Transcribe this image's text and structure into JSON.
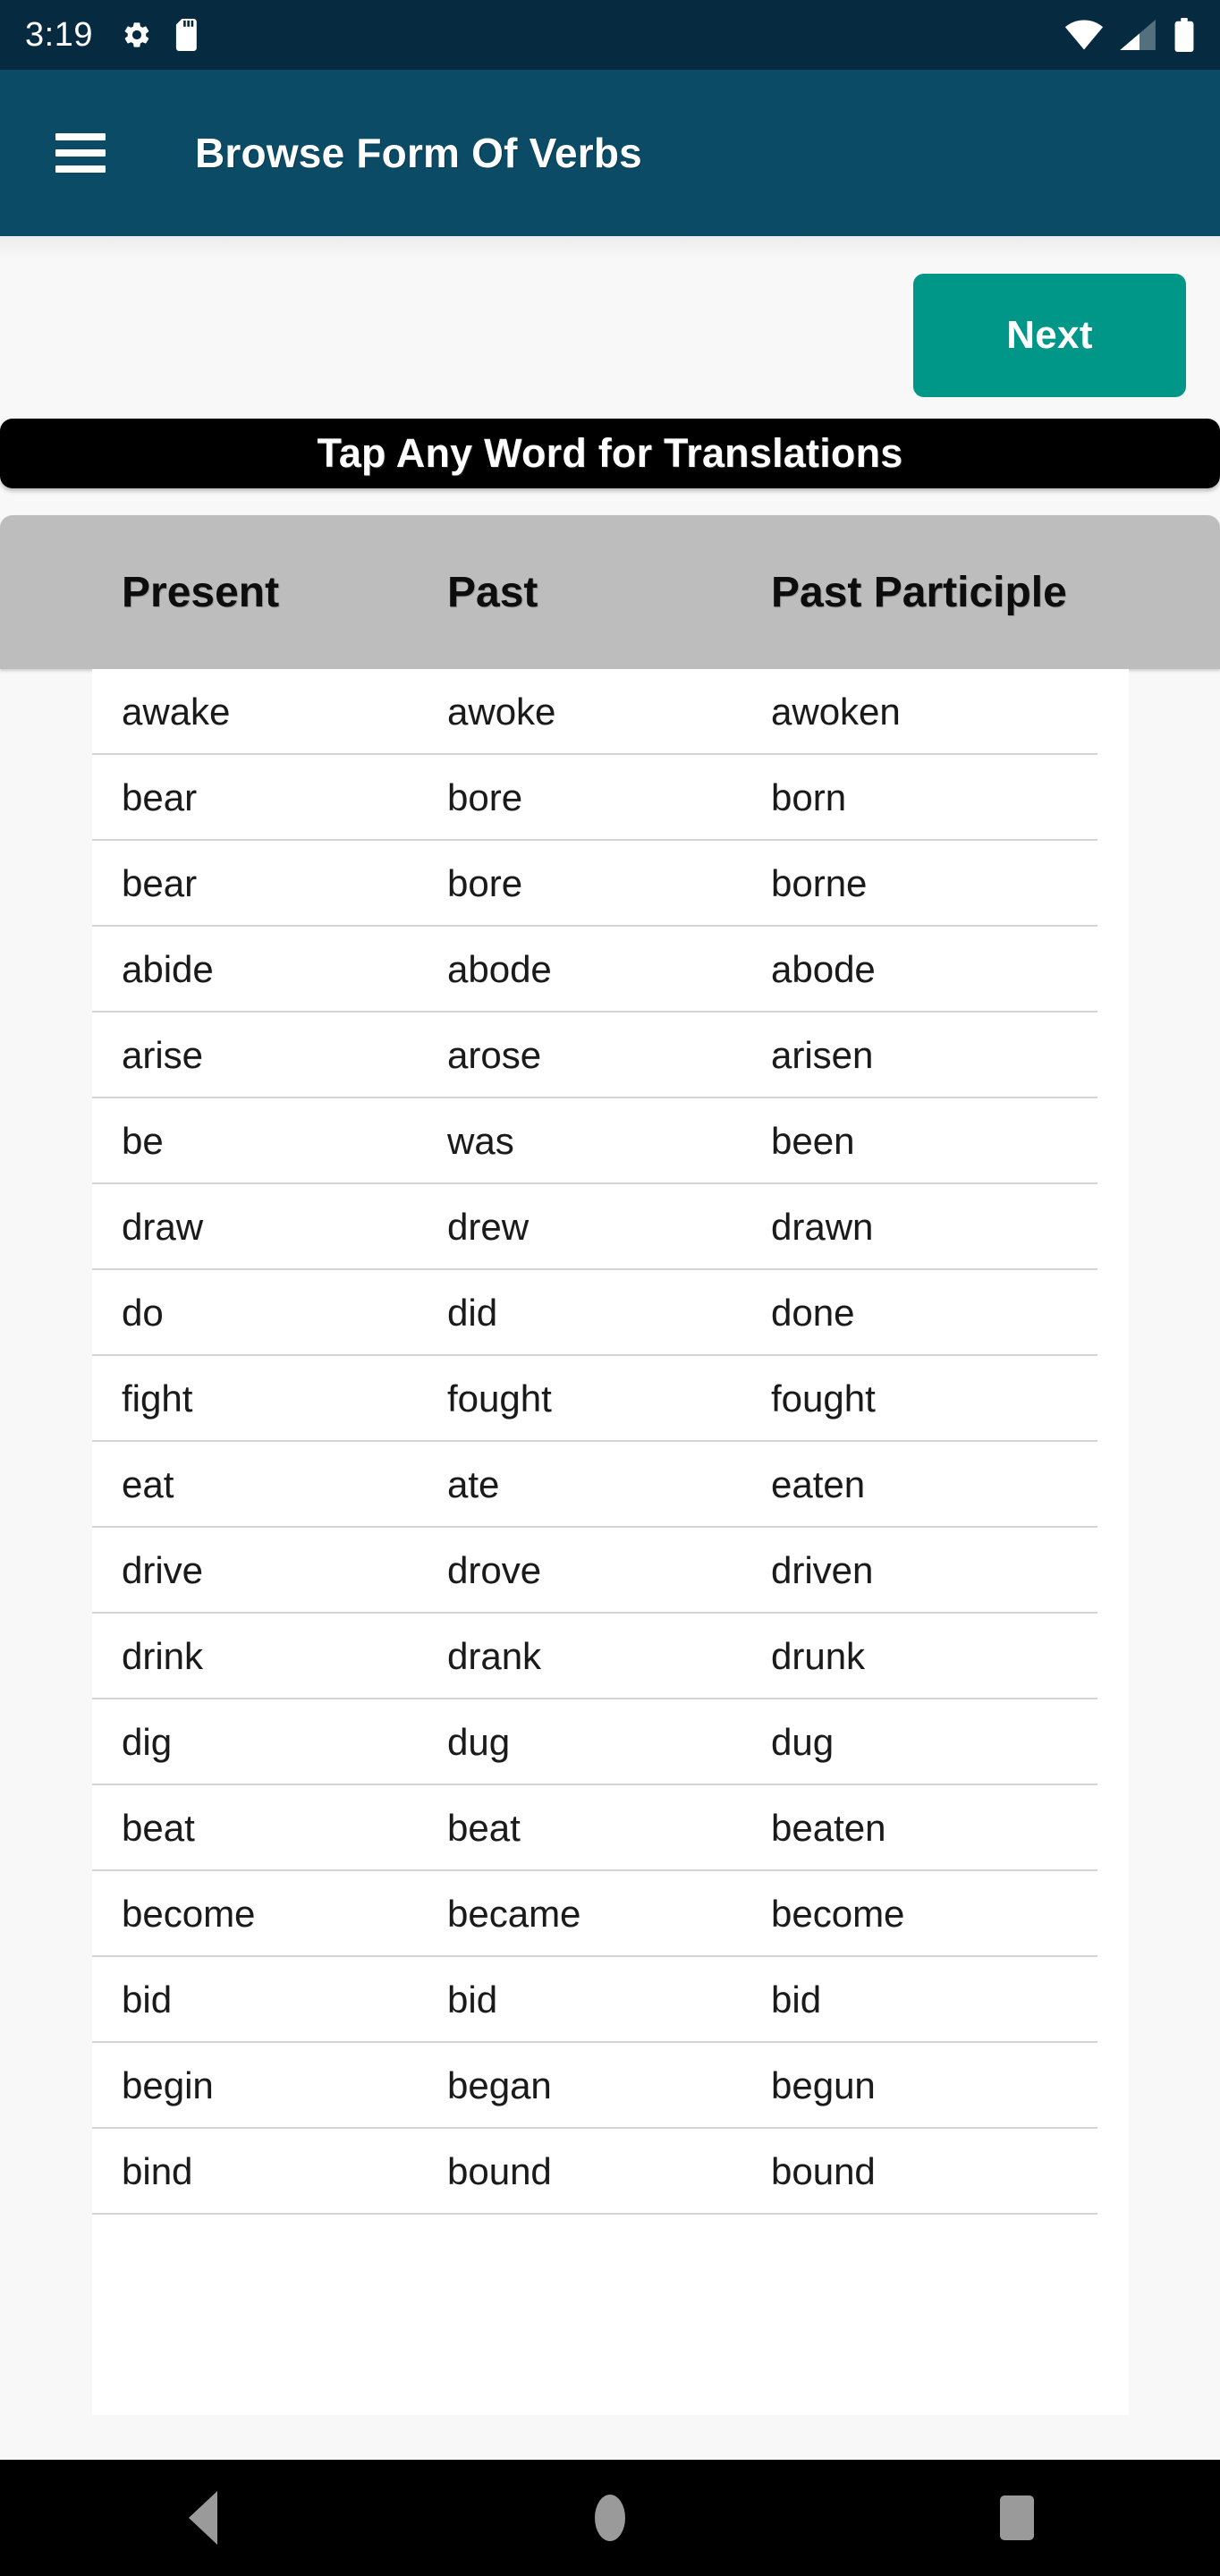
{
  "status_bar": {
    "time": "3:19",
    "left_icons": [
      "gear-icon",
      "sd-card-icon"
    ],
    "right_icons": [
      "wifi-icon",
      "cellular-signal-icon",
      "battery-icon"
    ],
    "background_color": "#062b40"
  },
  "app_bar": {
    "menu_icon": "hamburger-menu-icon",
    "title": "Browse Form Of Verbs",
    "background_color": "#0b4b66"
  },
  "toolbar": {
    "next_label": "Next",
    "next_color": "#009688"
  },
  "banner": {
    "text": "Tap Any Word for Translations",
    "background_color": "#000000",
    "text_color": "#ffffff"
  },
  "table": {
    "header_background": "#bdbdbd",
    "columns": [
      "Present",
      "Past",
      "Past Participle"
    ],
    "rows": [
      [
        "awake",
        "awoke",
        "awoken"
      ],
      [
        "bear",
        "bore",
        "born"
      ],
      [
        "bear",
        "bore",
        "borne"
      ],
      [
        "abide",
        "abode",
        "abode"
      ],
      [
        "arise",
        "arose",
        "arisen"
      ],
      [
        "be",
        "was",
        "been"
      ],
      [
        "draw",
        "drew",
        "drawn"
      ],
      [
        "do",
        "did",
        "done"
      ],
      [
        "fight",
        "fought",
        "fought"
      ],
      [
        "eat",
        "ate",
        "eaten"
      ],
      [
        "drive",
        "drove",
        "driven"
      ],
      [
        "drink",
        "drank",
        "drunk"
      ],
      [
        "dig",
        "dug",
        "dug"
      ],
      [
        "beat",
        "beat",
        "beaten"
      ],
      [
        "become",
        "became",
        "become"
      ],
      [
        "bid",
        "bid",
        "bid"
      ],
      [
        "begin",
        "began",
        "begun"
      ],
      [
        "bind",
        "bound",
        "bound"
      ]
    ]
  },
  "nav_bar": {
    "back": "back-triangle-icon",
    "home": "home-circle-icon",
    "recents": "recents-square-icon",
    "background_color": "#000000"
  }
}
